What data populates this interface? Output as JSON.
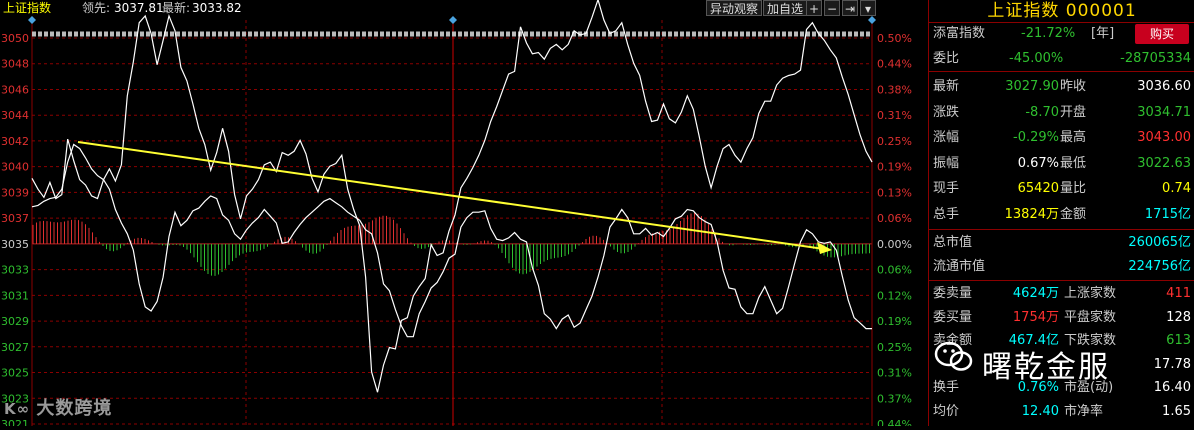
{
  "topbar": {
    "index_name": "上证指数",
    "lead_label": "领先:",
    "lead_value": "3037.81",
    "latest_label": "最新:",
    "latest_value": "3033.82",
    "btn_watch": "异动观察",
    "btn_add": "加自选",
    "btn_plus": "+",
    "btn_minus": "−",
    "btn_pin": "⇥",
    "btn_menu": "▾"
  },
  "axis_left": [
    "3050",
    "3048",
    "3046",
    "3044",
    "3042",
    "3040",
    "3039",
    "3037",
    "3035",
    "3033",
    "3031",
    "3029",
    "3027",
    "3025",
    "3023",
    "3021"
  ],
  "axis_right": [
    "0.50%",
    "0.44%",
    "0.38%",
    "0.31%",
    "0.25%",
    "0.19%",
    "0.13%",
    "0.06%",
    "0.00%",
    "0.06%",
    "0.12%",
    "0.19%",
    "0.25%",
    "0.31%",
    "0.37%",
    "0.44%"
  ],
  "colors": {
    "up": "#e03030",
    "down": "#2fbf2f",
    "price": "#ffffff",
    "avg": "#ffff00",
    "arrow": "#ffff33",
    "grid": "#8b0000"
  },
  "chart_data": {
    "type": "line",
    "x_sessions": 240,
    "ylim": [
      3021,
      3051
    ],
    "series": [
      {
        "values": [
          3039.3,
          3038.5,
          3037.9,
          3039.0,
          3037.8,
          3038.1,
          3042.2,
          3040.6,
          3039.2,
          3038.8,
          3038.0,
          3037.8,
          3039.2,
          3040.0,
          3039.1,
          3040.3,
          3045.4,
          3047.9,
          3050.8,
          3051.3,
          3050.0,
          3047.7,
          3049.5,
          3051.3,
          3050.2,
          3047.5,
          3046.5,
          3044.8,
          3043.0,
          3041.8,
          3039.9,
          3041.2,
          3043.0,
          3041.3,
          3038.1,
          3036.3,
          3038.0,
          3038.5,
          3039.2,
          3040.3,
          3040.5,
          3039.8,
          3041.2,
          3041.0,
          3041.3,
          3042.1,
          3041.1,
          3039.3,
          3038.3,
          3039.6,
          3040.2,
          3040.4,
          3041.0,
          3038.5,
          3037.0,
          3035.8,
          3032.0,
          3025.0,
          3023.5,
          3025.5,
          3026.8,
          3026.7,
          3028.8,
          3029.0,
          3030.6,
          3031.3,
          3031.9,
          3034.4,
          3033.6,
          3033.8,
          3035.4,
          3036.6,
          3038.6,
          3039.3,
          3040.1,
          3041.0,
          3042.1,
          3043.5,
          3044.6,
          3045.8,
          3047.0,
          3047.2,
          3050.5,
          3049.3,
          3048.5,
          3048.6,
          3048.1,
          3048.9,
          3049.2,
          3048.8,
          3049.2,
          3050.2,
          3049.9,
          3050.0,
          3051.2,
          3052.5,
          3051.0,
          3050.0,
          3050.2,
          3050.8,
          3049.2,
          3047.8,
          3046.9,
          3045.0,
          3043.5,
          3043.6,
          3044.8,
          3043.7,
          3043.4,
          3044.2,
          3045.4,
          3044.4,
          3042.4,
          3040.2,
          3038.6,
          3040.2,
          3041.5,
          3041.8,
          3041.0,
          3040.5,
          3041.5,
          3042.3,
          3044.1,
          3045.0,
          3045.0,
          3046.2,
          3046.7,
          3046.9,
          3047.0,
          3047.3,
          3050.3,
          3050.8,
          3050.0,
          3049.5,
          3048.8,
          3048.2,
          3046.8,
          3045.5,
          3044.0,
          3042.5,
          3041.3,
          3040.5
        ],
        "name": ""
      },
      {
        "values": [
          3037.2,
          3037.3,
          3037.6,
          3037.8,
          3037.9,
          3038.5,
          3040.5,
          3041.8,
          3041.5,
          3040.8,
          3040.0,
          3039.5,
          3039.2,
          3038.5,
          3037.0,
          3036.0,
          3035.2,
          3034.0,
          3031.5,
          3029.8,
          3029.5,
          3030.2,
          3032.0,
          3035.0,
          3036.8,
          3035.8,
          3036.2,
          3036.9,
          3037.1,
          3037.6,
          3038.0,
          3037.8,
          3036.6,
          3036.2,
          3035.2,
          3034.8,
          3035.5,
          3036.0,
          3036.4,
          3037.0,
          3036.5,
          3036.0,
          3034.5,
          3034.6,
          3035.3,
          3035.9,
          3036.4,
          3036.8,
          3037.2,
          3037.6,
          3037.8,
          3037.5,
          3037.2,
          3036.8,
          3036.5,
          3036.2,
          3035.5,
          3035.2,
          3033.8,
          3031.5,
          3031.0,
          3029.6,
          3028.4,
          3027.6,
          3027.6,
          3029.3,
          3030.2,
          3031.2,
          3031.6,
          3032.4,
          3033.4,
          3033.7,
          3035.7,
          3036.4,
          3036.8,
          3036.8,
          3036.9,
          3035.6,
          3034.8,
          3034.7,
          3034.9,
          3035.3,
          3034.8,
          3034.6,
          3032.7,
          3031.4,
          3029.3,
          3028.9,
          3028.2,
          3028.9,
          3029.2,
          3028.3,
          3028.6,
          3029.6,
          3030.6,
          3032.0,
          3033.6,
          3035.7,
          3036.3,
          3037.0,
          3036.4,
          3035.2,
          3035.2,
          3035.6,
          3035.1,
          3035.3,
          3035.0,
          3035.6,
          3036.3,
          3036.5,
          3037.0,
          3036.9,
          3036.4,
          3036.1,
          3035.9,
          3034.6,
          3032.5,
          3031.2,
          3031.1,
          3029.8,
          3029.3,
          3029.3,
          3030.5,
          3031.3,
          3030.3,
          3029.3,
          3029.7,
          3031.3,
          3033.0,
          3034.6,
          3035.5,
          3035.2,
          3034.6,
          3034.5,
          3034.6,
          3034.0,
          3032.1,
          3030.3,
          3029.0,
          3028.6,
          3028.2,
          3028.2
        ],
        "name": ""
      }
    ]
  },
  "panel": {
    "title": "上证指数 000001",
    "r1_l": "添富指数",
    "r1_v": "-21.72%",
    "r1_u": "[年]",
    "buy": "购买",
    "r2_l": "委比",
    "r2_v": "-45.00%",
    "r2_v2": "-28705334",
    "stats": [
      {
        "l": "最新",
        "v": "3027.90",
        "l2": "昨收",
        "v2": "3036.60",
        "c1": "#2fbf2f",
        "c2": "#ffffff"
      },
      {
        "l": "涨跌",
        "v": "-8.70",
        "l2": "开盘",
        "v2": "3034.71",
        "c1": "#2fbf2f",
        "c2": "#2fbf2f"
      },
      {
        "l": "涨幅",
        "v": "-0.29%",
        "l2": "最高",
        "v2": "3043.00",
        "c1": "#2fbf2f",
        "c2": "#ff3030"
      },
      {
        "l": "振幅",
        "v": "0.67%",
        "l2": "最低",
        "v2": "3022.63",
        "c1": "#ffffff",
        "c2": "#2fbf2f"
      },
      {
        "l": "现手",
        "v": "65420",
        "l2": "量比",
        "v2": "0.74",
        "c1": "#ffff00",
        "c2": "#ffff00"
      },
      {
        "l": "总手",
        "v": "13824万",
        "l2": "金额",
        "v2": "1715亿",
        "c1": "#ffff00",
        "c2": "#00ffff"
      }
    ],
    "mkt": [
      {
        "l": "总市值",
        "v": "260065亿"
      },
      {
        "l": "流通市值",
        "v": "224756亿"
      }
    ],
    "order": [
      {
        "l": "委卖量",
        "v": "4624万",
        "l2": "上涨家数",
        "v2": "411",
        "c2": "#ff3030"
      },
      {
        "l": "委买量",
        "v": "1754万",
        "l2": "平盘家数",
        "v2": "128",
        "c2": "#ffffff"
      },
      {
        "l": "卖金额",
        "v": "467.4亿",
        "l2": "下跌家数",
        "v2": "613",
        "c2": "#2fbf2f"
      },
      {
        "l": "",
        "v": "",
        "l2": "",
        "v2": "17.78",
        "c2": "#ffffff"
      },
      {
        "l": "换手",
        "v": "0.76%",
        "l2": "市盈(动)",
        "v2": "16.40",
        "c2": "#ffffff"
      },
      {
        "l": "均价",
        "v": "12.40",
        "l2": "市净率",
        "v2": "1.65",
        "c2": "#ffffff"
      }
    ]
  },
  "watermarks": {
    "left": "大数跨境",
    "right": "曙乾金服"
  }
}
